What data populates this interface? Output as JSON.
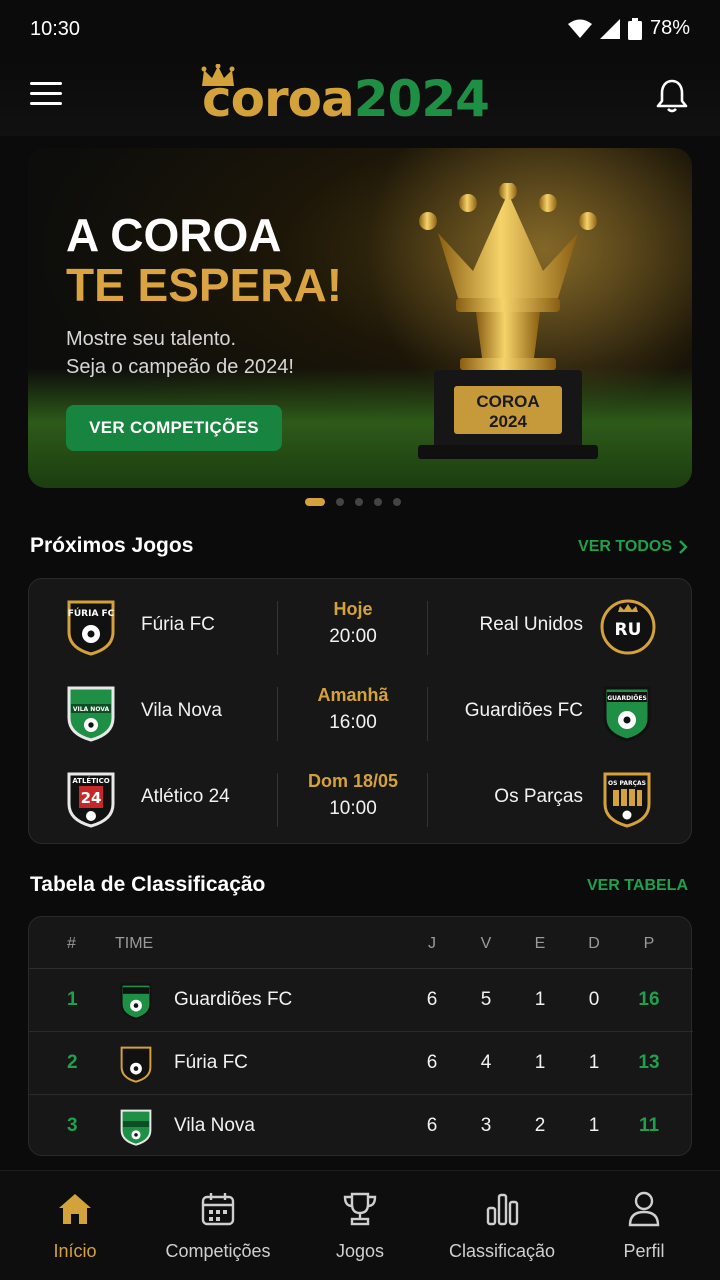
{
  "status_bar": {
    "time": "10:30",
    "battery": "78%"
  },
  "header": {
    "logo_word_1": "coroa",
    "logo_word_2": "2024"
  },
  "hero": {
    "title_line_1": "A COROA",
    "title_line_2": "TE ESPERA!",
    "subtitle_line_1": "Mostre seu talento.",
    "subtitle_line_2": "Seja o campeão de 2024!",
    "cta": "VER COMPETIÇÕES",
    "trophy_plate_1": "COROA",
    "trophy_plate_2": "2024"
  },
  "carousel": {
    "count": 5,
    "active": 0
  },
  "matches_section": {
    "title": "Próximos Jogos",
    "link": "VER TODOS",
    "matches": [
      {
        "home": "Fúria FC",
        "away": "Real Unidos",
        "day": "Hoje",
        "time": "20:00",
        "home_badge": "furia-fc",
        "away_badge": "real-unidos"
      },
      {
        "home": "Vila Nova",
        "away": "Guardiões FC",
        "day": "Amanhã",
        "time": "16:00",
        "home_badge": "vila-nova",
        "away_badge": "guardioes-fc"
      },
      {
        "home": "Atlético 24",
        "away": "Os Parças",
        "day": "Dom 18/05",
        "time": "10:00",
        "home_badge": "atletico-24",
        "away_badge": "os-parcas"
      }
    ]
  },
  "standings_section": {
    "title": "Tabela de Classificação",
    "link": "VER TABELA",
    "columns": {
      "pos": "#",
      "team": "TIME",
      "j": "J",
      "v": "V",
      "e": "E",
      "d": "D",
      "p": "P"
    },
    "rows": [
      {
        "pos": "1",
        "team": "Guardiões FC",
        "j": "6",
        "v": "5",
        "e": "1",
        "d": "0",
        "p": "16",
        "badge": "guardioes-fc"
      },
      {
        "pos": "2",
        "team": "Fúria FC",
        "j": "6",
        "v": "4",
        "e": "1",
        "d": "1",
        "p": "13",
        "badge": "furia-fc"
      },
      {
        "pos": "3",
        "team": "Vila Nova",
        "j": "6",
        "v": "3",
        "e": "2",
        "d": "1",
        "p": "11",
        "badge": "vila-nova"
      }
    ]
  },
  "bottom_nav": [
    {
      "label": "Início",
      "icon": "home-icon",
      "active": true
    },
    {
      "label": "Competições",
      "icon": "calendar-icon",
      "active": false
    },
    {
      "label": "Jogos",
      "icon": "trophy-icon",
      "active": false
    },
    {
      "label": "Classificação",
      "icon": "bar-chart-icon",
      "active": false
    },
    {
      "label": "Perfil",
      "icon": "user-icon",
      "active": false
    }
  ],
  "colors": {
    "gold": "#d4a23a",
    "green": "#1fa04d",
    "button_green": "#17843f",
    "background": "#0b0b0b",
    "card": "#171717"
  }
}
